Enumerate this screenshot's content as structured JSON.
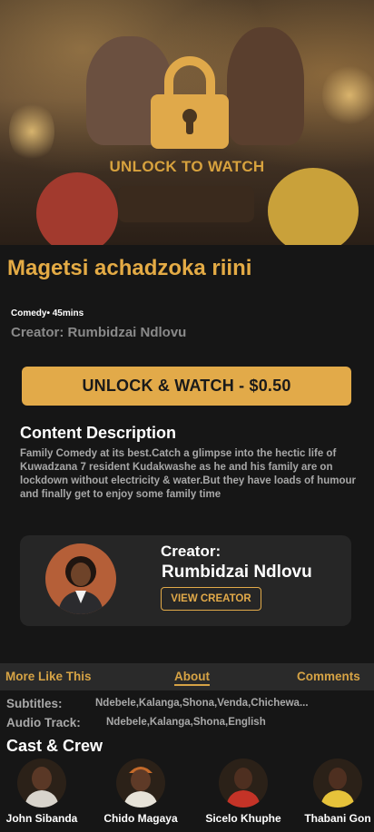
{
  "hero": {
    "overlay_text": "UNLOCK TO WATCH",
    "lock_icon": "lock-icon",
    "lock_color": "#e0a94a"
  },
  "movie": {
    "title": "Magetsi achadzoka riini",
    "genre": "Comedy",
    "duration": "45mins",
    "creator_line": "Creator: Rumbidzai Ndlovu"
  },
  "unlock_button": {
    "label": "UNLOCK & WATCH - $0.50"
  },
  "description": {
    "heading": "Content Description",
    "text": "Family Comedy at its best.Catch a glimpse into the hectic life of Kuwadzana 7 resident Kudakwashe as he and his family are on lockdown without electricity &  water.But they have loads of humour and finally get to enjoy some family time"
  },
  "creator_card": {
    "label": "Creator:",
    "name": "Rumbidzai Ndlovu",
    "button": "VIEW CREATOR"
  },
  "tabs": [
    {
      "label": "More Like This",
      "active": false
    },
    {
      "label": "About",
      "active": true
    },
    {
      "label": "Comments",
      "active": false
    }
  ],
  "about": {
    "subtitles_label": "Subtitles:",
    "subtitles_value": "Ndebele,Kalanga,Shona,Venda,Chichewa...",
    "audio_label": "Audio Track:",
    "audio_value": "Ndebele,Kalanga,Shona,English"
  },
  "cast": {
    "heading": "Cast & Crew",
    "members": [
      {
        "name": "John Sibanda"
      },
      {
        "name": "Chido Magaya"
      },
      {
        "name": "Sicelo Khuphe"
      },
      {
        "name": "Thabani Gon"
      }
    ]
  },
  "colors": {
    "accent": "#e2aa49",
    "background": "#161616",
    "card": "#262626"
  }
}
